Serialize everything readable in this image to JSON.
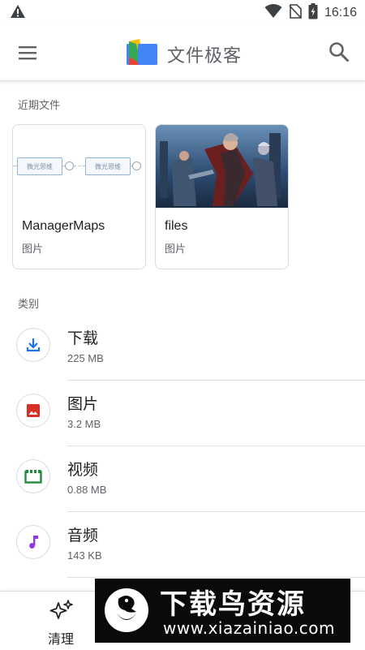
{
  "status_bar": {
    "time": "16:16"
  },
  "app_bar": {
    "title": "文件极客",
    "menu_icon": "hamburger-menu-icon",
    "search_icon": "search-icon",
    "brand_colors": [
      "#4285f4",
      "#fbbc04",
      "#34a853",
      "#ea4335"
    ]
  },
  "recent": {
    "label": "近期文件",
    "items": [
      {
        "name": "ManagerMaps",
        "type": "图片",
        "thumb_text": "微光思维"
      },
      {
        "name": "files",
        "type": "图片"
      }
    ]
  },
  "categories": {
    "label": "类别",
    "items": [
      {
        "title": "下载",
        "size": "225 MB",
        "icon": "download-icon",
        "color": "#1a73e8"
      },
      {
        "title": "图片",
        "size": "3.2 MB",
        "icon": "image-icon",
        "color": "#d93025"
      },
      {
        "title": "视频",
        "size": "0.88 MB",
        "icon": "video-icon",
        "color": "#1e8e3e"
      },
      {
        "title": "音频",
        "size": "143 KB",
        "icon": "music-note-icon",
        "color": "#9334e6"
      }
    ]
  },
  "bottom_nav": {
    "clean_label": "清理",
    "clean_icon": "sparkle-icon"
  },
  "watermark": {
    "title": "下载鸟资源",
    "url": "www.xiazainiao.com"
  }
}
